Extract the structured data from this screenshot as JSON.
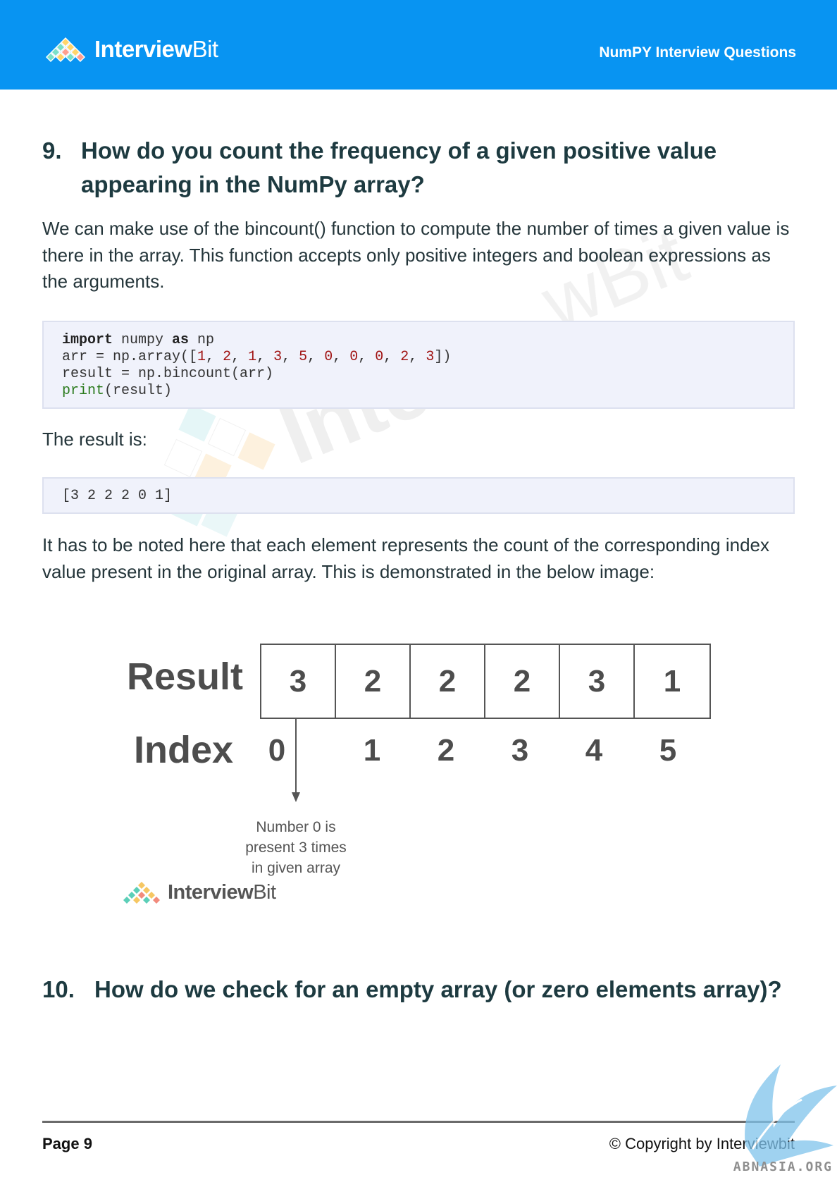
{
  "header": {
    "logo_text_bold": "Interview",
    "logo_text_light": "Bit",
    "title": "NumPY Interview Questions"
  },
  "q9": {
    "number": "9.",
    "title": "How do you count the frequency of a given positive value appearing in the NumPy array?"
  },
  "paragraphs": {
    "p1": "We can make use of the bincount() function to compute the number of times a given value is there in the array. This function accepts only positive integers and boolean expressions as the arguments.",
    "p2": "The result is:",
    "p3": "It has to be noted here that each element represents the count of the corresponding index value present in the original array. This is demonstrated in the below image:"
  },
  "code1": {
    "kw_import": "import",
    "numpy": " numpy ",
    "kw_as": "as",
    "np": " np",
    "arr_prefix": "arr = np.array([",
    "values": [
      "1",
      "2",
      "1",
      "3",
      "5",
      "0",
      "0",
      "0",
      "2",
      "3"
    ],
    "sep": ", ",
    "arr_suffix": "])",
    "line3": "result = np.bincount(arr)",
    "print_fn": "print",
    "print_arg": "(result)"
  },
  "code2": {
    "output": "[3 2 2 2 0 1]"
  },
  "diagram": {
    "result_label": "Result",
    "index_label": "Index",
    "result_values": [
      "3",
      "2",
      "2",
      "2",
      "3",
      "1"
    ],
    "index_values": [
      "0",
      "1",
      "2",
      "3",
      "4",
      "5"
    ],
    "note_lines": [
      "Number 0 is",
      "present 3 times",
      "in given array"
    ],
    "logo_text_bold": "Interview",
    "logo_text_light": "Bit"
  },
  "q10": {
    "number": "10.",
    "title": "How do we check for an empty array (or zero elements array)?"
  },
  "footer": {
    "page": "Page 9",
    "copyright": "© Copyright by Interviewbit",
    "corner_text": "ABNASIA.ORG"
  },
  "colors": {
    "header_bg": "#0894f2",
    "heading": "#1d3a40",
    "code_bg": "#f0f2fb",
    "number_literal": "#a11414"
  }
}
